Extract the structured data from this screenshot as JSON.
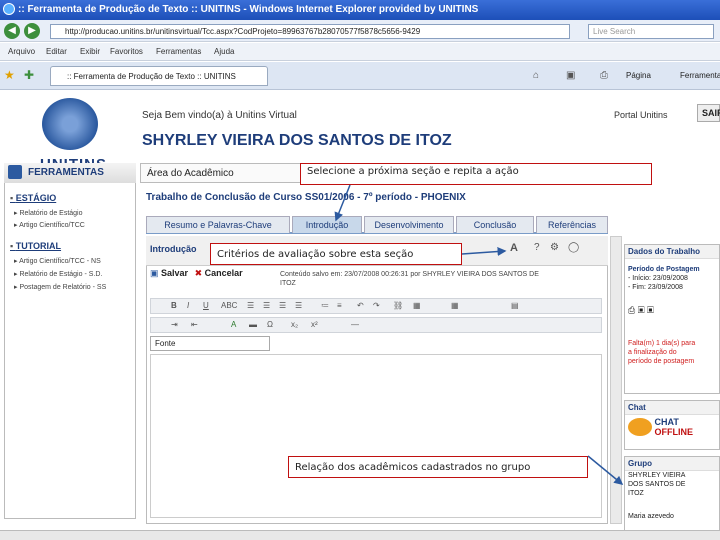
{
  "window": {
    "title": ":: Ferramenta de Produção de Texto :: UNITINS - Windows Internet Explorer provided by UNITINS",
    "address": "http://producao.unitins.br/unitinsvirtual/Tcc.aspx?CodProjeto=89963767b28070577f5878c5656-9429",
    "search_placeholder": "Live Search",
    "tab_label": ":: Ferramenta de Produção de Texto :: UNITINS",
    "menu": [
      "Arquivo",
      "Editar",
      "Exibir",
      "Favoritos",
      "Ferramentas",
      "Ajuda"
    ],
    "page_menu": "Página",
    "tools_menu": "Ferramentas"
  },
  "header": {
    "logo": "UNITINS",
    "welcome": "Seja Bem vindo(a) à Unitins Virtual",
    "portal_link": "Portal Unitins",
    "sair_label": "SAIR",
    "user_name": "SHYRLEY VIEIRA DOS SANTOS DE ITOZ"
  },
  "sidebar": {
    "title": "FERRAMENTAS",
    "sections": [
      {
        "label": "ESTÁGIO",
        "items": [
          "Relatório de Estágio",
          "Artigo Científico/TCC"
        ]
      },
      {
        "label": "TUTORIAL",
        "items": [
          "Artigo Científico/TCC - NS",
          "Relatório de Estágio - S.D.",
          "Postagem de Relatório - SS"
        ]
      }
    ]
  },
  "main": {
    "area_title": "Área do Acadêmico",
    "work_title": "Trabalho de Conclusão de Curso SS01/2006 - 7º período - PHOENIX",
    "tabs": [
      "Resumo e Palavras-Chave",
      "Introdução",
      "Desenvolvimento",
      "Conclusão",
      "Referências"
    ],
    "active_tab": "Introdução",
    "editor_title": "Introdução",
    "save_label": "Salvar",
    "cancel_label": "Cancelar",
    "saved_info": "Conteúdo salvo em: 23/07/2008 00:26:31 por SHYRLEY VIEIRA DOS SANTOS DE ITOZ",
    "font_select": "Fonte"
  },
  "right": {
    "work_data_title": "Dados do Trabalho",
    "posting_period_title": "Período de Postagem",
    "start": "- Início: 23/09/2008",
    "end": "- Fim: 23/09/2008",
    "warning": [
      "Falta(m) 1 dia(s) para",
      "a finalização do",
      "período de postagem"
    ],
    "chat_title": "Chat",
    "chat_label": "CHAT",
    "chat_status": "OFFLINE",
    "group_title": "Grupo",
    "group_members": [
      "SHYRLEY VIEIRA",
      "DOS SANTOS DE",
      "ITOZ",
      "Maria azevedo"
    ]
  },
  "callouts": {
    "next_section": "Selecione a próxima seção e repita a ação",
    "criteria": "Critérios de avaliação sobre esta seção",
    "group": "Relação dos acadêmicos cadastrados no grupo"
  },
  "colors": {
    "brand": "#1e3d7a",
    "callout_border": "#c01010",
    "warning": "#d02020"
  }
}
